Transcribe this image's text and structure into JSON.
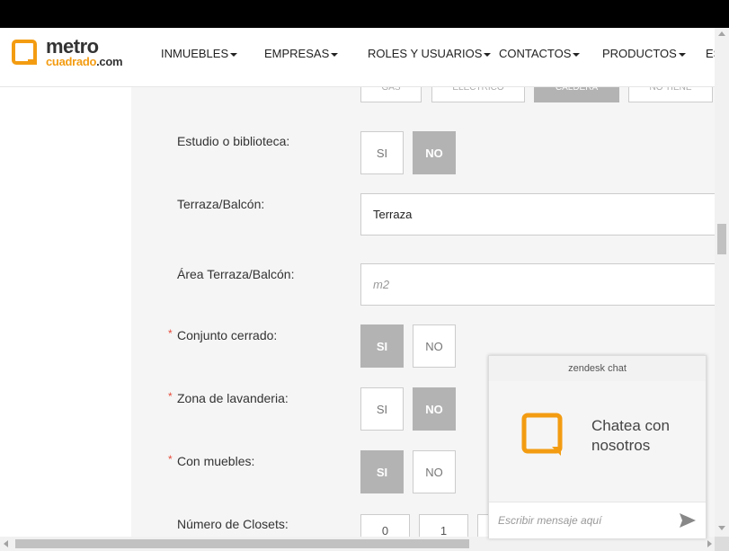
{
  "logo": {
    "line1": "metro",
    "line2a": "cuadrado",
    "line2b": ".com"
  },
  "nav": [
    "INMUEBLES",
    "EMPRESAS",
    "ROLES Y USUARIOS",
    "CONTACTOS",
    "PRODUCTOS",
    "ES"
  ],
  "top_tabs": [
    "GAS",
    "ELECTRICO",
    "CALDERA",
    "NO TIENE"
  ],
  "form": {
    "estudio_label": "Estudio o biblioteca:",
    "terraza_label": "Terraza/Balcón:",
    "terraza_value": "Terraza",
    "area_label": "Área Terraza/Balcón:",
    "area_placeholder": "m2",
    "conjunto_label": "Conjunto cerrado:",
    "lavanderia_label": "Zona de lavanderia:",
    "muebles_label": "Con muebles:",
    "closets_label": "Número de Closets:",
    "si": "SI",
    "no": "NO",
    "required_mark": "*"
  },
  "closets_options": [
    "0",
    "1"
  ],
  "selections": {
    "estudio": "NO",
    "conjunto": "SI",
    "lavanderia": "NO",
    "muebles": "SI",
    "calentador": "CALDERA"
  },
  "chat": {
    "header": "zendesk chat",
    "title_line1": "Chatea con",
    "title_line2": "nosotros",
    "input_placeholder": "Escribir mensaje aquí"
  },
  "colors": {
    "brand_orange": "#f39c12",
    "selected_gray": "#b3b3b3",
    "required_red": "#e74c3c"
  }
}
